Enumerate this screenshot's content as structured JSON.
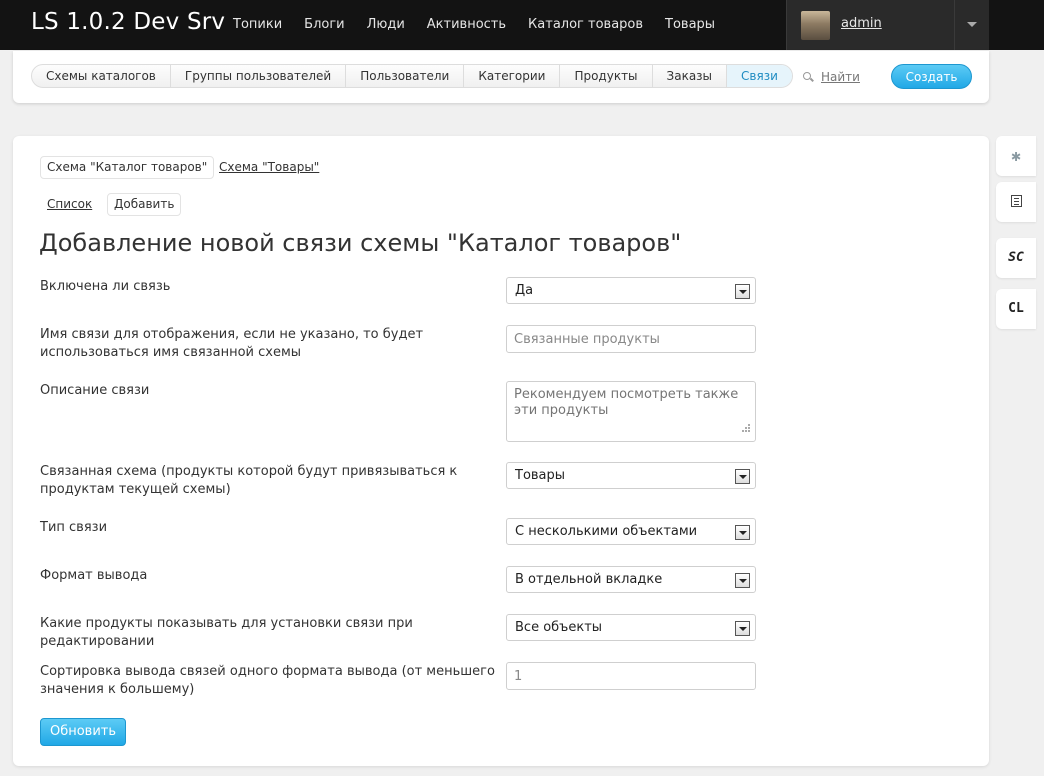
{
  "header": {
    "brand": "LS 1.0.2 Dev Srv",
    "nav": [
      "Топики",
      "Блоги",
      "Люди",
      "Активность",
      "Каталог товаров",
      "Товары"
    ],
    "username": "admin"
  },
  "subnav": {
    "tabs": [
      "Схемы каталогов",
      "Группы пользователей",
      "Пользователи",
      "Категории",
      "Продукты",
      "Заказы",
      "Связи"
    ],
    "active_tab": "Связи",
    "search_label": "Найти",
    "create_label": "Создать"
  },
  "content": {
    "schema_tabs": [
      "Схема \"Каталог товаров\"",
      "Схема \"Товары\""
    ],
    "sub_links": [
      "Список",
      "Добавить"
    ],
    "title": "Добавление новой связи схемы \"Каталог товаров\"",
    "fields": {
      "enabled_label": "Включена ли связь",
      "enabled_value": "Да",
      "display_name_label": "Имя связи для отображения, если не указано, то будет использоваться имя связанной схемы",
      "display_name_placeholder": "Связанные продукты",
      "description_label": "Описание связи",
      "description_placeholder": "Рекомендуем посмотреть также эти продукты",
      "linked_schema_label": "Связанная схема (продукты которой будут привязываться к продуктам текущей схемы)",
      "linked_schema_value": "Товары",
      "link_type_label": "Тип связи",
      "link_type_value": "С несколькими объектами",
      "output_format_label": "Формат вывода",
      "output_format_value": "В отдельной вкладке",
      "products_shown_label": "Какие продукты показывать для установки связи при редактировании",
      "products_shown_value": "Все объекты",
      "sort_label": "Сортировка вывода связей одного формата вывода (от меньшего значения к большему)",
      "sort_placeholder": "1"
    },
    "submit_label": "Обновить"
  },
  "sidebar_buttons": [
    "SC",
    "CL"
  ]
}
